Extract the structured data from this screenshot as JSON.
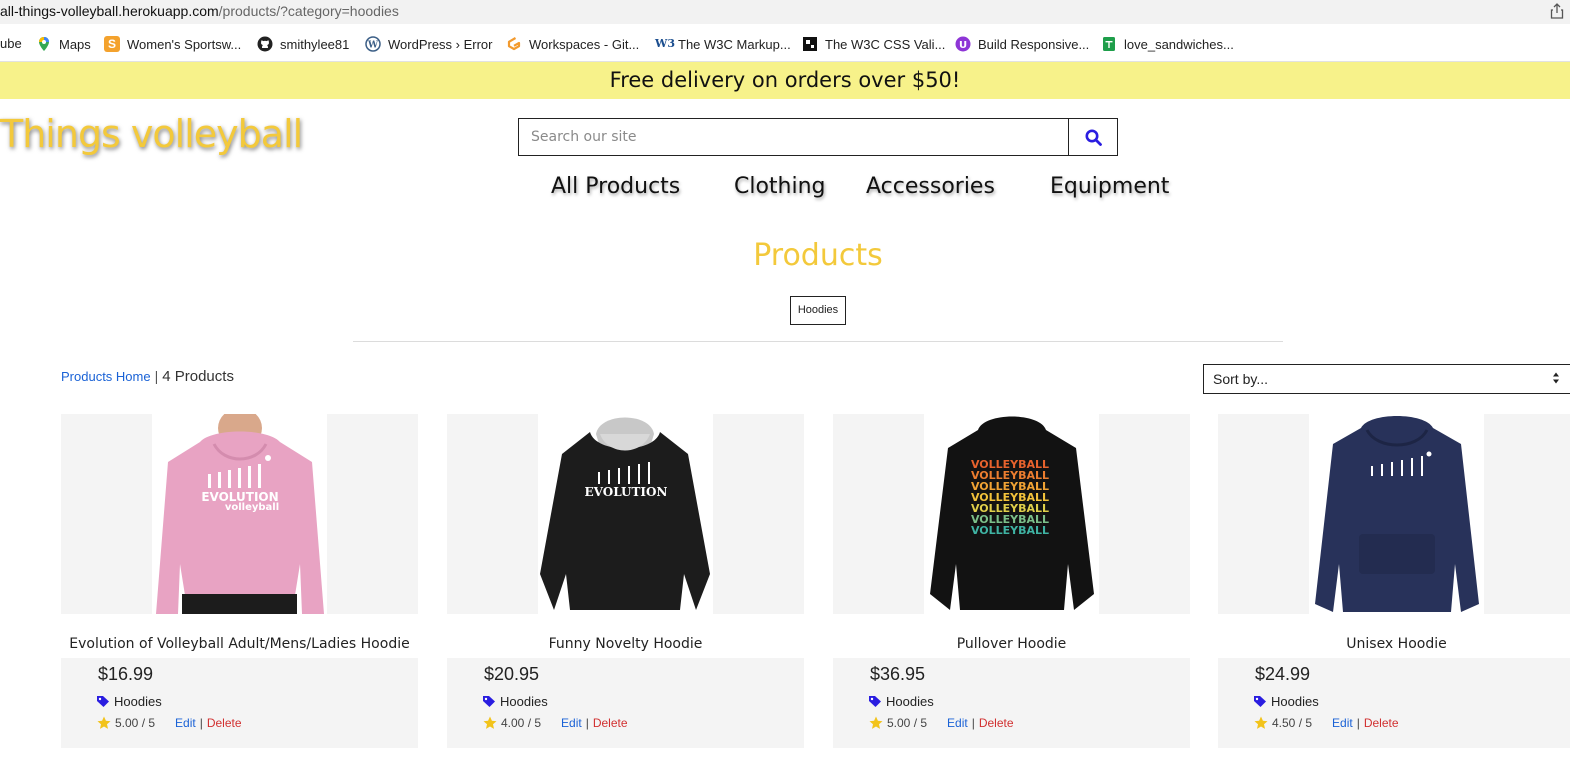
{
  "browser": {
    "url_host": "all-things-volleyball.herokuapp.com",
    "url_path": "/products/?category=hoodies",
    "bookmarks": [
      {
        "label": "ube",
        "icon": "youtube-icon",
        "color": "#e62117"
      },
      {
        "label": "Maps",
        "icon": "maps-pin-icon",
        "color": "#34a853"
      },
      {
        "label": "Women's Sportsw...",
        "icon": "sportswear-s-icon",
        "color": "#f4a22d"
      },
      {
        "label": "smithylee81",
        "icon": "github-icon",
        "color": "#222222"
      },
      {
        "label": "WordPress › Error",
        "icon": "wordpress-icon",
        "color": "#3b5e86"
      },
      {
        "label": "Workspaces - Git...",
        "icon": "gitpod-icon",
        "color": "#f29a2e"
      },
      {
        "label": "The W3C Markup...",
        "icon": "w3c-icon",
        "color": "#1b4e8f"
      },
      {
        "label": "The W3C CSS Vali...",
        "icon": "w3c-css-icon",
        "color": "#111111"
      },
      {
        "label": "Build Responsive...",
        "icon": "course-icon",
        "color": "#8e35d6"
      },
      {
        "label": "love_sandwiches...",
        "icon": "sheets-icon",
        "color": "#1e9e4a"
      }
    ]
  },
  "promo": {
    "text": "Free delivery on orders over $50!"
  },
  "brand": {
    "logo_text": "Things volleyball"
  },
  "search": {
    "placeholder": "Search our site"
  },
  "nav": {
    "all_products": "All Products",
    "clothing": "Clothing",
    "accessories": "Accessories",
    "equipment": "Equipment"
  },
  "main": {
    "title": "Products",
    "category_badge": "Hoodies",
    "breadcrumb_home": "Products Home",
    "breadcrumb_sep": "|",
    "product_count": "4 Products",
    "sort_label": "Sort by..."
  },
  "products": [
    {
      "name": "Evolution of Volleyball Adult/Mens/Ladies Hoodie",
      "price": "$16.99",
      "category": "Hoodies",
      "rating": "5.00 / 5",
      "edit": "Edit",
      "sep": "|",
      "delete": "Delete",
      "hoodie_color": "#e8a3c3",
      "print_text": "EVOLUTION volleyball"
    },
    {
      "name": "Funny Novelty Hoodie",
      "price": "$20.95",
      "category": "Hoodies",
      "rating": "4.00 / 5",
      "edit": "Edit",
      "sep": "|",
      "delete": "Delete",
      "hoodie_color": "#1c1c1c",
      "print_text": "EVOLUTION"
    },
    {
      "name": "Pullover Hoodie",
      "price": "$36.95",
      "category": "Hoodies",
      "rating": "5.00 / 5",
      "edit": "Edit",
      "sep": "|",
      "delete": "Delete",
      "hoodie_color": "#121212",
      "print_text": "VOLLEYBALL"
    },
    {
      "name": "Unisex Hoodie",
      "price": "$24.99",
      "category": "Hoodies",
      "rating": "4.50 / 5",
      "edit": "Edit",
      "sep": "|",
      "delete": "Delete",
      "hoodie_color": "#28325a",
      "print_text": ""
    }
  ],
  "colors": {
    "promo_bg": "#f7f28a",
    "brand_yellow": "#f3c93b",
    "link_blue": "#1a62d6",
    "delete_red": "#d13030",
    "tag_blue": "#2a1de0",
    "star_gold": "#f2c31a"
  }
}
